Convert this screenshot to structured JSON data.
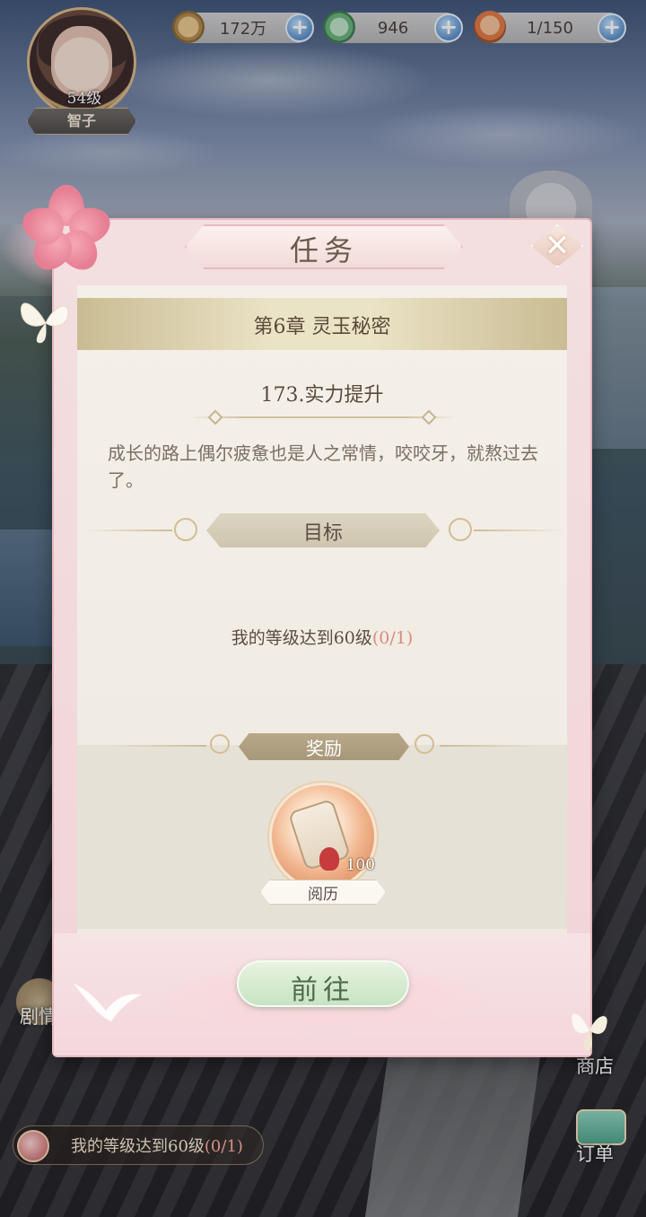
{
  "player": {
    "level": "54级",
    "name": "智子"
  },
  "resources": [
    {
      "icon": "paw-coin-icon",
      "value": "172万"
    },
    {
      "icon": "jade-icon",
      "value": "946"
    },
    {
      "icon": "food-icon",
      "value": "1/150"
    }
  ],
  "dialog": {
    "title": "任务",
    "chapter": "第6章  灵玉秘密",
    "quest_title": "173.实力提升",
    "description": "成长的路上偶尔疲惫也是人之常情，咬咬牙，就熬过去了。",
    "goal_header": "目标",
    "goal_text": "我的等级达到60级",
    "goal_progress": "(0/1)",
    "reward_header": "奖励",
    "reward": {
      "icon": "scroll-icon",
      "count": "100",
      "name": "阅历"
    },
    "go_button": "前往"
  },
  "side": {
    "left_label": "剧情",
    "right_label_1": "商店",
    "right_label_2": "订单"
  },
  "tracker": {
    "text": "我的等级达到60级",
    "progress": "(0/1)"
  },
  "colors": {
    "panel_pink": "#f1d4d8",
    "go_green": "#c7e3c2",
    "progress_red": "#d88c82"
  }
}
